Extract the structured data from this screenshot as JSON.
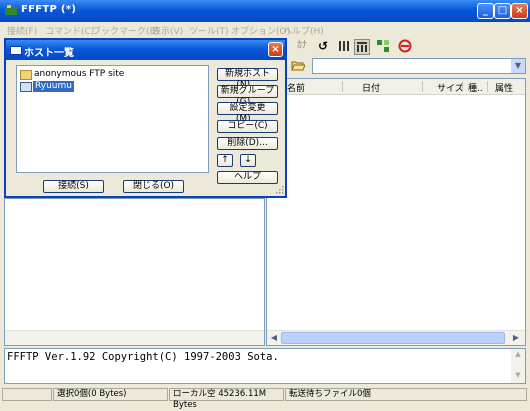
{
  "window": {
    "title": "FFFTP (*)",
    "buttons": [
      "_",
      "□",
      "X"
    ]
  },
  "menu": [
    "接続(F)",
    "コマンド(C)",
    "ブックマーク(B)",
    "表示(V)",
    "ツール(T)",
    "オプション(O)",
    "ヘルプ(H)"
  ],
  "toolbar_icons": [
    "kana-icon",
    "refresh-icon",
    "list-view-icon",
    "detail-view-icon",
    "sync-icon",
    "stop-icon"
  ],
  "remote_header": {
    "columns": [
      "名前",
      "日付",
      "サイズ",
      "種..",
      "属性"
    ]
  },
  "log": {
    "text": "FFFTP Ver.1.92 Copyright(C) 1997-2003 Sota."
  },
  "status": {
    "selection": "選択0個(0 Bytes)",
    "local_free": "ローカル空 45236.11M Bytes",
    "queue": "転送待ちファイル0個"
  },
  "dialog": {
    "title": "ホスト一覧",
    "tree": [
      {
        "label": "anonymous FTP site",
        "type": "folder",
        "selected": false
      },
      {
        "label": "Ryuumu",
        "type": "host",
        "selected": true
      }
    ],
    "buttons": {
      "new_host": "新規ホスト(N)...",
      "new_group": "新規グループ(G)...",
      "edit": "設定変更(M)...",
      "copy": "コピー(C)",
      "delete": "削除(D)...",
      "up": "↑",
      "down": "↓",
      "help": "ヘルプ",
      "connect": "接続(S)",
      "close": "閉じる(O)"
    }
  },
  "colors": {
    "titlebar": "#0a58d8",
    "selection": "#316ac5",
    "face": "#ece9d8"
  }
}
